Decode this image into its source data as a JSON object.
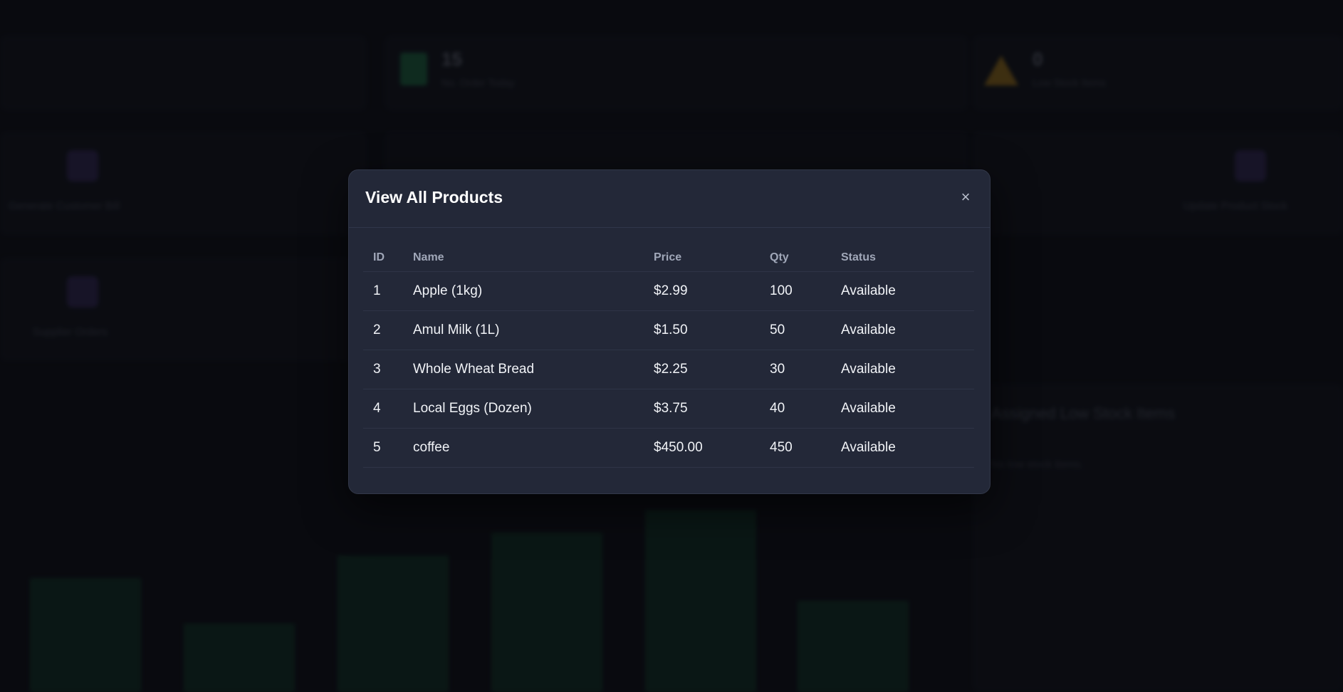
{
  "modal": {
    "title": "View All Products",
    "close_glyph": "×",
    "columns": {
      "id": "ID",
      "name": "Name",
      "price": "Price",
      "qty": "Qty",
      "status": "Status"
    },
    "rows": [
      {
        "id": "1",
        "name": "Apple (1kg)",
        "price": "$2.99",
        "qty": "100",
        "status": "Available"
      },
      {
        "id": "2",
        "name": "Amul Milk (1L)",
        "price": "$1.50",
        "qty": "50",
        "status": "Available"
      },
      {
        "id": "3",
        "name": "Whole Wheat Bread",
        "price": "$2.25",
        "qty": "30",
        "status": "Available"
      },
      {
        "id": "4",
        "name": "Local Eggs (Dozen)",
        "price": "$3.75",
        "qty": "40",
        "status": "Available"
      },
      {
        "id": "5",
        "name": "coffee",
        "price": "$450.00",
        "qty": "450",
        "status": "Available"
      }
    ]
  },
  "background": {
    "stats": [
      {
        "value": "15",
        "label": "No. Order Today",
        "icon": "receipt-icon"
      },
      {
        "value": "0",
        "label": "Low Stock Items",
        "icon": "warning-icon"
      }
    ],
    "actions": [
      {
        "label": "Generate Customer Bill",
        "icon": "bill-icon"
      },
      {
        "label": "Update Product Stock",
        "icon": "edit-icon"
      },
      {
        "label": "Supplier Orders",
        "icon": "truck-icon"
      }
    ],
    "assigned_title": "Assigned Low Stock Items",
    "assigned_sub": "No low stock items.",
    "bar_levels": [
      0.5,
      0.3,
      0.6,
      0.7,
      0.8,
      0.4
    ]
  },
  "colors": {
    "modal_bg": "#232838",
    "accent_green": "#1f7a4a",
    "warning": "#b8861a",
    "icon_purple": "#3a2d63"
  }
}
